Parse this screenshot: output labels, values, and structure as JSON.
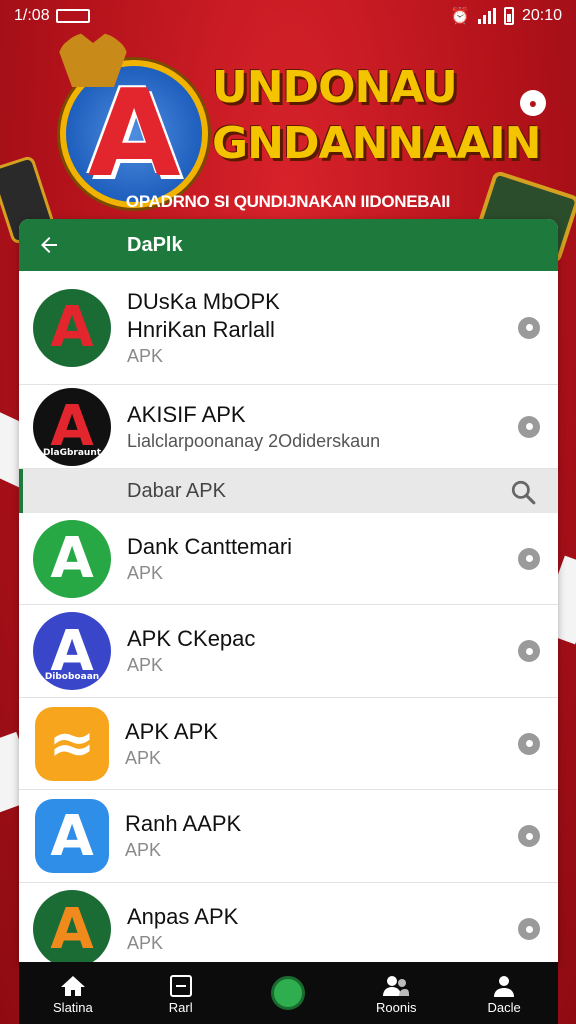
{
  "status_bar": {
    "time": "1/:08",
    "right_text": "20:10"
  },
  "banner": {
    "title_line1": "UNDONAU",
    "title_line2": "GNDANNAAIN",
    "subtitle": "OPADRNO SI QUNDIJNAKAN IIDONEBAII",
    "emblem_letter": "A"
  },
  "appbar": {
    "title": "DaPlk",
    "back_icon": "arrow-left-icon"
  },
  "apps_top": [
    {
      "title": "DUsKa MbOPK",
      "title2": "HnriKan Rarlall",
      "subtitle": "APK",
      "icon_letter": "A",
      "icon_bg": "#1b6b34",
      "icon_fg": "#e3262d",
      "icon_caption": ""
    },
    {
      "title": "AKISIF APK",
      "subtitle": "Lialclarpoonanay 2Odiderskaun",
      "icon_letter": "A",
      "icon_bg": "#111111",
      "icon_fg": "#e3262d",
      "icon_caption": "DlaGbraunt"
    }
  ],
  "section": {
    "label": "Dabar APK"
  },
  "apps_list": [
    {
      "title": "Dank Canttemari",
      "subtitle": "APK",
      "icon_letter": "A",
      "icon_bg": "#27a844",
      "icon_caption": ""
    },
    {
      "title": "APK CKepac",
      "subtitle": "APK",
      "icon_letter": "A",
      "icon_bg": "#3a46c9",
      "icon_caption": "Diboboaan"
    },
    {
      "title": "APK APK",
      "subtitle": "APK",
      "icon_letter": "≈",
      "icon_bg": "#f6a51c",
      "icon_caption": ""
    },
    {
      "title": "Ranh AAPK",
      "subtitle": "APK",
      "icon_letter": "A",
      "icon_bg": "#2f8fe8",
      "icon_caption": ""
    },
    {
      "title": "Anpas APK",
      "subtitle": "APK",
      "icon_letter": "A",
      "icon_bg": "#1b6b34",
      "icon_caption": ""
    }
  ],
  "bottom_nav": [
    {
      "label": "Slatina",
      "icon": "home-icon"
    },
    {
      "label": "Rarl",
      "icon": "square-icon"
    },
    {
      "label": "",
      "icon": "circle-icon"
    },
    {
      "label": "Roonis",
      "icon": "people-icon"
    },
    {
      "label": "Dacle",
      "icon": "person-icon"
    }
  ],
  "colors": {
    "green": "#1e7a3c",
    "red": "#c11820",
    "gold": "#f5c400"
  }
}
